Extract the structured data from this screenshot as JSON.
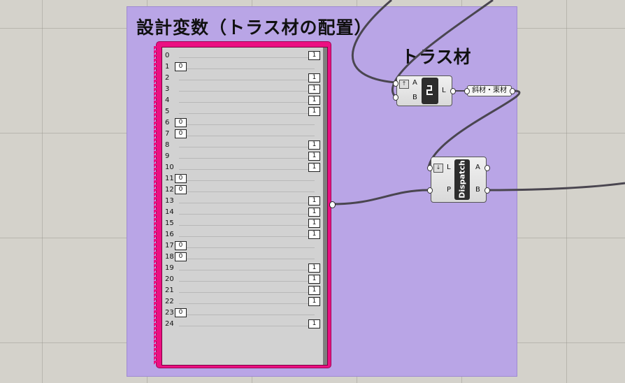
{
  "group": {
    "title": "設計変数（トラス材の配置）"
  },
  "scribble": {
    "text": "トラス材"
  },
  "gene_pool": {
    "rows": [
      {
        "index": "0",
        "value": "1"
      },
      {
        "index": "1",
        "value": "0"
      },
      {
        "index": "2",
        "value": "1"
      },
      {
        "index": "3",
        "value": "1"
      },
      {
        "index": "4",
        "value": "1"
      },
      {
        "index": "5",
        "value": "1"
      },
      {
        "index": "6",
        "value": "0"
      },
      {
        "index": "7",
        "value": "0"
      },
      {
        "index": "8",
        "value": "1"
      },
      {
        "index": "9",
        "value": "1"
      },
      {
        "index": "10",
        "value": "1"
      },
      {
        "index": "11",
        "value": "0"
      },
      {
        "index": "12",
        "value": "0"
      },
      {
        "index": "13",
        "value": "1"
      },
      {
        "index": "14",
        "value": "1"
      },
      {
        "index": "15",
        "value": "1"
      },
      {
        "index": "16",
        "value": "1"
      },
      {
        "index": "17",
        "value": "0"
      },
      {
        "index": "18",
        "value": "0"
      },
      {
        "index": "19",
        "value": "1"
      },
      {
        "index": "20",
        "value": "1"
      },
      {
        "index": "21",
        "value": "1"
      },
      {
        "index": "22",
        "value": "1"
      },
      {
        "index": "23",
        "value": "0"
      },
      {
        "index": "24",
        "value": "1"
      }
    ]
  },
  "list_item": {
    "input_a": "A",
    "input_b": "B",
    "output_l": "L",
    "icon": "list-item-icon"
  },
  "panel": {
    "text": "斜材・束材"
  },
  "dispatch": {
    "input_l": "L",
    "input_p": "P",
    "output_a": "A",
    "output_b": "B",
    "label": "Dispatch"
  },
  "colors": {
    "canvas": "#d4d2cb",
    "group": "#b9a5e6",
    "gene_pool": "#ec0f82",
    "wire": "#4a4650"
  }
}
